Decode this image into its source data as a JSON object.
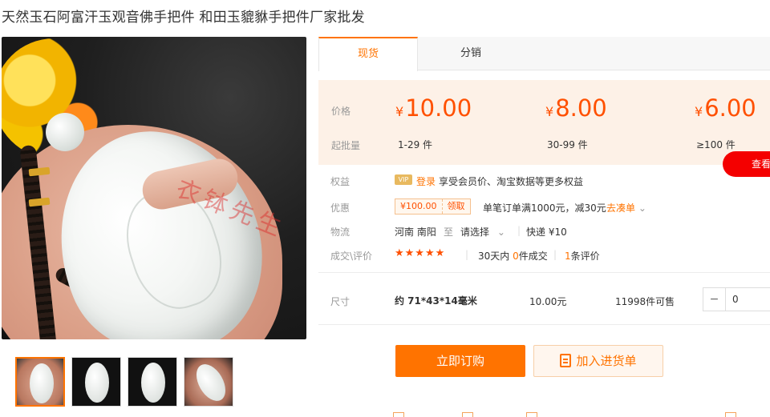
{
  "product": {
    "title": "天然玉石阿富汗玉观音佛手把件 和田玉貔貅手把件厂家批发",
    "watermark": "衣钵先生"
  },
  "tabs": [
    {
      "label": "现货",
      "active": true
    },
    {
      "label": "分销",
      "active": false
    }
  ],
  "pricing": {
    "price_label": "价格",
    "moq_label": "起批量",
    "currency": "¥",
    "tiers": [
      {
        "price": "10.00",
        "qty": "1-29 件"
      },
      {
        "price": "8.00",
        "qty": "30-99 件"
      },
      {
        "price": "6.00",
        "qty": "≥100 件"
      }
    ],
    "check_button": "查看"
  },
  "benefits": {
    "label": "权益",
    "vip": "VIP",
    "login": "登录",
    "text": "享受会员价、淘宝数据等更多权益"
  },
  "discount": {
    "label": "优惠",
    "coupon_amount": "¥100.00",
    "coupon_get": "领取",
    "rule": "单笔订单满1000元，减30元",
    "link": "去凑单"
  },
  "logistics": {
    "label": "物流",
    "origin": "河南 南阳",
    "to": "至",
    "select": "请选择",
    "express": "快递 ¥10"
  },
  "reviews": {
    "label": "成交\\评价",
    "stars": "★★★★★",
    "days_prefix": "30天内",
    "sold_count": "0",
    "sold_suffix": "件成交",
    "review_count": "1",
    "review_suffix": "条评价"
  },
  "sku": {
    "label": "尺寸",
    "size": "约 71*43*14毫米",
    "price": "10.00元",
    "stock": "11998件可售",
    "minus": "−",
    "quantity": "0"
  },
  "actions": {
    "order": "立即订购",
    "cart": "加入进货单"
  },
  "colors": {
    "accent": "#ff7300",
    "price": "#ff5000",
    "price_bg": "#fdf1e7",
    "badge_red": "#f40000"
  }
}
